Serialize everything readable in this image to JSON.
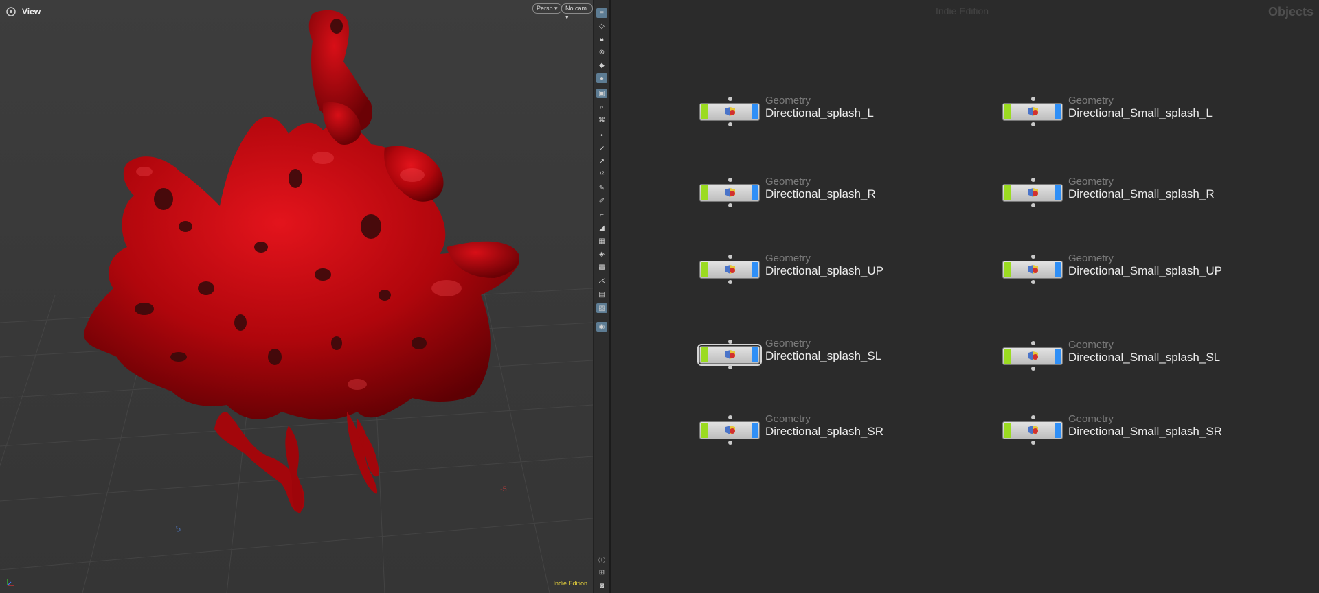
{
  "viewport": {
    "title": "View",
    "perspective_label": "Persp",
    "camera_label": "No cam",
    "edition_label": "Indie Edition",
    "grid_labels": [
      "5",
      "-5"
    ]
  },
  "toolbar": {
    "icons": [
      "display-options-icon",
      "handle-tool-icon",
      "lock-view-icon",
      "snap-icon",
      "light-icon",
      "headlight-icon",
      "camera-view-icon",
      "select-visible-icon",
      "select-tool-icon",
      "point-icon",
      "normal-icon",
      "vector-icon",
      "point-numbers-icon",
      "brush-icon",
      "paint-icon",
      "measure-icon",
      "ruler-icon",
      "background-icon",
      "ground-plane-icon",
      "texture-icon",
      "skeleton-icon",
      "layout-icon",
      "image-icon",
      "geo-light-icon",
      "info-icon",
      "quad-view-icon",
      "render-icon"
    ]
  },
  "network": {
    "edition_label": "Indie Edition",
    "context_label": "Objects",
    "nodes": [
      {
        "type": "Geometry",
        "name": "Directional_splash_L"
      },
      {
        "type": "Geometry",
        "name": "Directional_splash_R"
      },
      {
        "type": "Geometry",
        "name": "Directional_splash_UP"
      },
      {
        "type": "Geometry",
        "name": "Directional_splash_SL"
      },
      {
        "type": "Geometry",
        "name": "Directional_splash_SR"
      },
      {
        "type": "Geometry",
        "name": "Directional_Small_splash_L"
      },
      {
        "type": "Geometry",
        "name": "Directional_Small_splash_R"
      },
      {
        "type": "Geometry",
        "name": "Directional_Small_splash_UP"
      },
      {
        "type": "Geometry",
        "name": "Directional_Small_splash_SL"
      },
      {
        "type": "Geometry",
        "name": "Directional_Small_splash_SR"
      }
    ],
    "selected_node": "Directional_splash_SL"
  },
  "colors": {
    "splash": "#b0060c",
    "node_left_flag": "#9bdb21",
    "node_right_flag": "#2f8ff6",
    "edition_yellow": "#e7d23c"
  }
}
